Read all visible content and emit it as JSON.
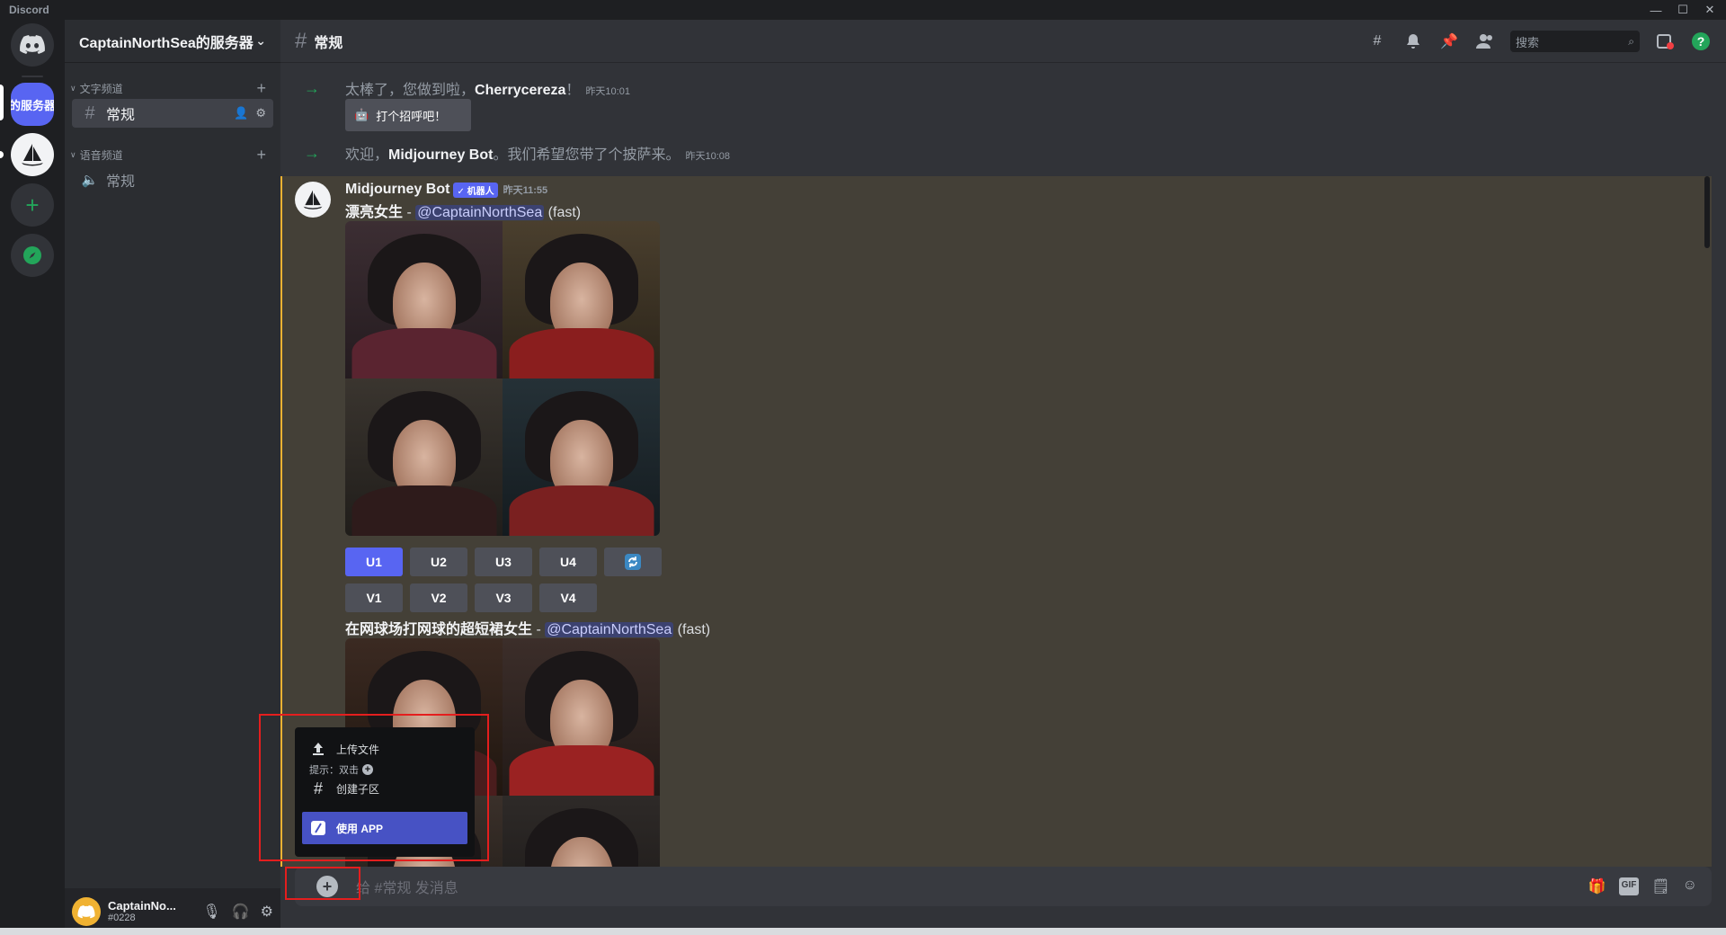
{
  "app": {
    "title": "Discord"
  },
  "window_controls": [
    "—",
    "☐",
    "✕"
  ],
  "rail": {
    "selected_server_label": "的服务器"
  },
  "server": {
    "name": "CaptainNorthSea的服务器",
    "text_category": "文字频道",
    "voice_category": "语音频道",
    "text_channel": "常规",
    "voice_channel": "常规"
  },
  "user": {
    "name": "CaptainNo...",
    "tag": "#0228"
  },
  "channel_header": {
    "name": "常规",
    "search_placeholder": "搜索"
  },
  "system_messages": [
    {
      "prefix": "太棒了，您做到啦，",
      "user": "Cherrycereza",
      "suffix": "！",
      "time": "昨天10:01"
    },
    {
      "prefix": "欢迎，",
      "user": "Midjourney Bot",
      "suffix": "。我们希望您带了个披萨来。",
      "time": "昨天10:08"
    }
  ],
  "wave_button": "打个招呼吧！",
  "bot_message": {
    "author": "Midjourney Bot",
    "badge": "✓ 机器人",
    "time": "昨天11:55",
    "prompt1": {
      "text": "漂亮女生",
      "sep": " - ",
      "mention": "@CaptainNorthSea",
      "mode": " (fast)"
    },
    "prompt2": {
      "text": "在网球场打网球的超短裙女生",
      "sep": " - ",
      "mention": "@CaptainNorthSea",
      "mode": " (fast)"
    },
    "upscale_buttons": [
      "U1",
      "U2",
      "U3",
      "U4"
    ],
    "variation_buttons": [
      "V1",
      "V2",
      "V3",
      "V4"
    ]
  },
  "input": {
    "placeholder": "给 #常规 发消息"
  },
  "popup": {
    "upload": "上传文件",
    "hint": "提示：双击",
    "thread": "创建子区",
    "app": "使用 APP"
  },
  "colors": {
    "accent": "#5865f2",
    "highlight": "#444037",
    "mention_border": "#f0b232",
    "annotation_red": "#e41e1e"
  }
}
